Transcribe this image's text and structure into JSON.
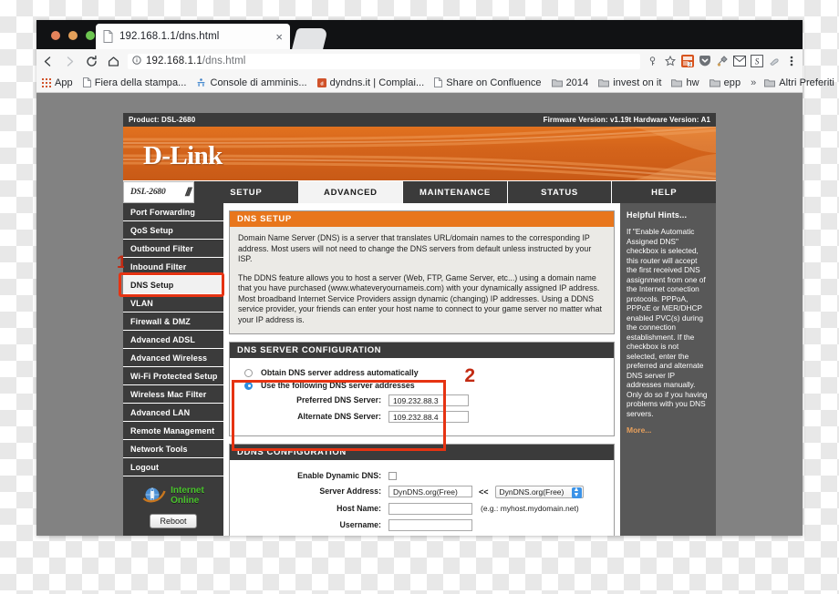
{
  "browser": {
    "tab": {
      "title": "192.168.1.1/dns.html",
      "close_label": "×"
    },
    "url_host": "192.168.1.1",
    "url_path": "/dns.html",
    "bookmarks": [
      {
        "label": "App",
        "icon": "apps-grid-icon"
      },
      {
        "label": "Fiera della stampa...",
        "icon": "page-icon"
      },
      {
        "label": "Console di amminis...",
        "icon": "console-icon"
      },
      {
        "label": "dyndns.it | Complai...",
        "icon": "dyndns-icon"
      },
      {
        "label": "Share on Confluence",
        "icon": "page-icon"
      },
      {
        "label": "2014",
        "icon": "folder-icon"
      },
      {
        "label": "invest on it",
        "icon": "folder-icon"
      },
      {
        "label": "hw",
        "icon": "folder-icon"
      },
      {
        "label": "epp",
        "icon": "folder-icon"
      }
    ],
    "overflow_label": "»",
    "other_bookmarks": {
      "label": "Altri Preferiti",
      "icon": "folder-icon"
    },
    "toolbar_icons": [
      "back-icon",
      "forward-icon",
      "reload-icon",
      "home-icon"
    ],
    "omnibox_icons": [
      "info-icon",
      "key-icon",
      "star-icon"
    ],
    "extension_icons": [
      "calendar-extension-icon",
      "pocket-extension-icon",
      "tools-extension-icon",
      "mail-extension-icon",
      "s-extension-icon",
      "paint-extension-icon"
    ],
    "menu_icon": "kebab-menu-icon"
  },
  "router": {
    "product_label": "Product: DSL-2680",
    "version_label": "Firmware Version: v1.19t Hardware Version: A1",
    "brand": "D-Link",
    "model_tab": "DSL-2680",
    "nav_tabs": [
      {
        "label": "SETUP",
        "active": false
      },
      {
        "label": "ADVANCED",
        "active": true
      },
      {
        "label": "MAINTENANCE",
        "active": false
      },
      {
        "label": "STATUS",
        "active": false
      },
      {
        "label": "HELP",
        "active": false
      }
    ],
    "sidebar": {
      "items": [
        {
          "label": "Port Forwarding",
          "selected": false
        },
        {
          "label": "QoS Setup",
          "selected": false
        },
        {
          "label": "Outbound Filter",
          "selected": false
        },
        {
          "label": "Inbound Filter",
          "selected": false
        },
        {
          "label": "DNS Setup",
          "selected": true
        },
        {
          "label": "VLAN",
          "selected": false
        },
        {
          "label": "Firewall & DMZ",
          "selected": false
        },
        {
          "label": "Advanced ADSL",
          "selected": false
        },
        {
          "label": "Advanced Wireless",
          "selected": false
        },
        {
          "label": "Wi-Fi Protected Setup",
          "selected": false
        },
        {
          "label": "Wireless Mac Filter",
          "selected": false
        },
        {
          "label": "Advanced LAN",
          "selected": false
        },
        {
          "label": "Remote Management",
          "selected": false
        },
        {
          "label": "Network Tools",
          "selected": false
        },
        {
          "label": "Logout",
          "selected": false
        }
      ],
      "status_line1": "Internet",
      "status_line2": "Online",
      "reboot_label": "Reboot"
    },
    "dns_setup": {
      "title": "DNS SETUP",
      "paragraph1": "Domain Name Server (DNS) is a server that translates URL/domain names to the corresponding IP address. Most users will not need to change the DNS servers from default unless instructed by your ISP.",
      "paragraph2": "The DDNS feature allows you to host a server (Web, FTP, Game Server, etc...) using a domain name that you have purchased (www.whateveryournameis.com) with your dynamically assigned IP address. Most broadband Internet Service Providers assign dynamic (changing) IP addresses. Using a DDNS service provider, your friends can enter your host name to connect to your game server no matter what your IP address is."
    },
    "dns_server_config": {
      "title": "DNS SERVER CONFIGURATION",
      "option_auto": "Obtain DNS server address automatically",
      "option_manual": "Use the following DNS server addresses",
      "preferred_label": "Preferred DNS Server:",
      "preferred_value": "109.232.88.3",
      "alternate_label": "Alternate DNS Server:",
      "alternate_value": "109.232.88.4"
    },
    "ddns_config": {
      "title": "DDNS CONFIGURATION",
      "enable_label": "Enable Dynamic DNS:",
      "server_label": "Server Address:",
      "server_value": "DynDNS.org(Free)",
      "arrows": "<<",
      "server_select_value": "DynDNS.org(Free)",
      "host_label": "Host Name:",
      "host_value": "",
      "host_hint": "(e.g.: myhost.mydomain.net)",
      "username_label": "Username:",
      "username_value": ""
    },
    "hints": {
      "title": "Helpful Hints...",
      "body": "If \"Enable Automatic Assigned DNS\" checkbox is selected, this router will accept the first received DNS assignment from one of the Internet conection protocols. PPPoA, PPPoE or MER/DHCP enabled PVC(s) during the connection establishment. If the checkbox is not selected, enter the preferred and alternate DNS server IP addresses manually. Only do so if you having problems with you DNS servers.",
      "more_label": "More..."
    }
  },
  "annotations": {
    "marker1": "1",
    "marker2": "2",
    "highlight_color": "#e63312"
  }
}
